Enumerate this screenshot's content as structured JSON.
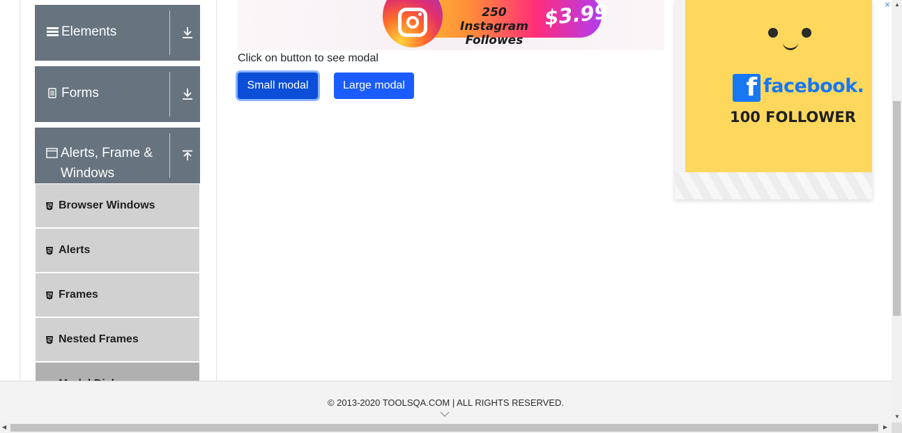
{
  "sidebar": {
    "groups": [
      {
        "label": "Elements",
        "icon": "hamburger-icon",
        "arrow": "download-arrow-icon"
      },
      {
        "label": "Forms",
        "icon": "document-icon",
        "arrow": "download-arrow-icon"
      },
      {
        "label": "Alerts, Frame & Windows",
        "icon": "window-icon",
        "arrow": "upload-arrow-icon"
      }
    ],
    "items": [
      {
        "label": "Browser Windows"
      },
      {
        "label": "Alerts"
      },
      {
        "label": "Frames"
      },
      {
        "label": "Nested Frames"
      },
      {
        "label": "Modal Dialogs"
      }
    ]
  },
  "banner": {
    "promo": "250 Instagram Followes",
    "price": "$3.99"
  },
  "main": {
    "prompt": "Click on button to see modal",
    "small_button": "Small modal",
    "large_button": "Large modal"
  },
  "side_ad": {
    "brand": "facebook.",
    "count": "100 FOLLOWER",
    "close": "×"
  },
  "footer": {
    "text": "© 2013-2020 TOOLSQA.COM | ALL RIGHTS RESERVED."
  },
  "colors": {
    "group_bg": "#67737e",
    "item_bg": "#d1d1d1",
    "button": "#1a5cff",
    "facebook_blue": "#1877f2",
    "ad_yellow": "#fdd85d"
  }
}
